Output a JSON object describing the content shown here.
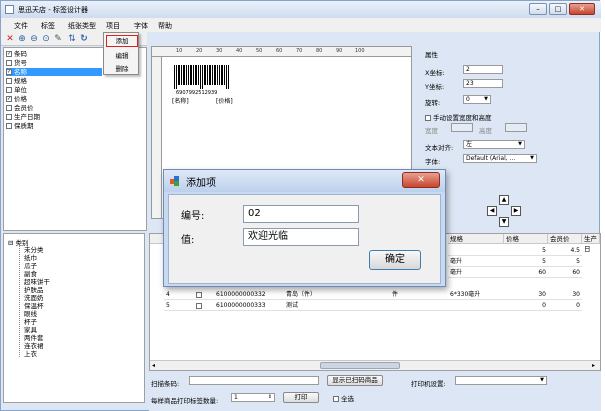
{
  "window": {
    "title": "思迅天店 - 标签设计器",
    "min": "–",
    "max": "□",
    "close": "✕"
  },
  "menu": {
    "items": [
      "文件",
      "标签",
      "纸张类型",
      "项目",
      "字体",
      "帮助"
    ]
  },
  "dropdown": {
    "items": [
      "添加",
      "编辑",
      "删除"
    ]
  },
  "fields": [
    {
      "label": "条码",
      "checked": true,
      "selected": false
    },
    {
      "label": "货号",
      "checked": false,
      "selected": false
    },
    {
      "label": "名称",
      "checked": true,
      "selected": true
    },
    {
      "label": "规格",
      "checked": false,
      "selected": false
    },
    {
      "label": "单位",
      "checked": false,
      "selected": false
    },
    {
      "label": "价格",
      "checked": true,
      "selected": false
    },
    {
      "label": "会员价",
      "checked": false,
      "selected": false
    },
    {
      "label": "生产日期",
      "checked": false,
      "selected": false
    },
    {
      "label": "保质期",
      "checked": false,
      "selected": false
    }
  ],
  "ruler": {
    "ticks": [
      "10",
      "20",
      "30",
      "40",
      "50",
      "60",
      "70",
      "80",
      "90",
      "100"
    ]
  },
  "label_preview": {
    "barcode_number": "6907992512939",
    "name_text": "[名称]",
    "price_text": "[价格]"
  },
  "properties": {
    "title": "属性",
    "x_label": "X坐标:",
    "x_value": "2",
    "y_label": "Y坐标:",
    "y_value": "23",
    "rotate_label": "旋转:",
    "rotate_value": "0",
    "manual_size_label": "手动设置宽度和高度",
    "width_label": "宽度",
    "height_label": "高度",
    "align_label": "文本对齐:",
    "align_value": "左",
    "font_label": "字体:",
    "font_value": "Default (Arial, ..."
  },
  "arrows": {
    "up": "▲",
    "down": "▼",
    "left": "◀",
    "right": "▶"
  },
  "tree": {
    "root": "类别",
    "items": [
      "未分类",
      "纸巾",
      "瓜子",
      "副食",
      "超味饼干",
      "护肤品",
      "洗面奶",
      "保温杯",
      "眼线",
      "杯子",
      "家具",
      "两件套",
      "连衣裙",
      "上衣"
    ]
  },
  "grid": {
    "headers": [
      "规格",
      "价格",
      "会员价",
      "生产日"
    ],
    "rows_top": [
      {
        "spec": "",
        "price": "5",
        "member": "4.5"
      },
      {
        "spec": "毫升",
        "price": "5",
        "member": "5"
      },
      {
        "spec": "毫升",
        "price": "60",
        "member": "60"
      }
    ],
    "rows": [
      {
        "no": "4",
        "code": "6100000000332",
        "name": "青岛（件）",
        "unit": "件",
        "spec": "6*330毫升",
        "price": "30",
        "member": "30"
      },
      {
        "no": "5",
        "code": "6100000000333",
        "name": "测试",
        "unit": "",
        "spec": "",
        "price": "0",
        "member": "0"
      }
    ]
  },
  "bottom": {
    "scan_label": "扫描条码:",
    "show_scanned": "显示已扫码商品",
    "printer_label": "打印机设置:",
    "copies_label": "每样商品打印标签数量:",
    "copies_value": "1",
    "print": "打印",
    "select_all": "全选"
  },
  "dialog": {
    "title": "添加项",
    "close": "✕",
    "num_label": "编号:",
    "num_value": "02",
    "value_label": "值:",
    "value_value": "欢迎光临",
    "ok": "确定"
  },
  "colors": {
    "selection": "#3399ff",
    "highlight_border": "#e02020",
    "accent": "#3c7fb1"
  }
}
